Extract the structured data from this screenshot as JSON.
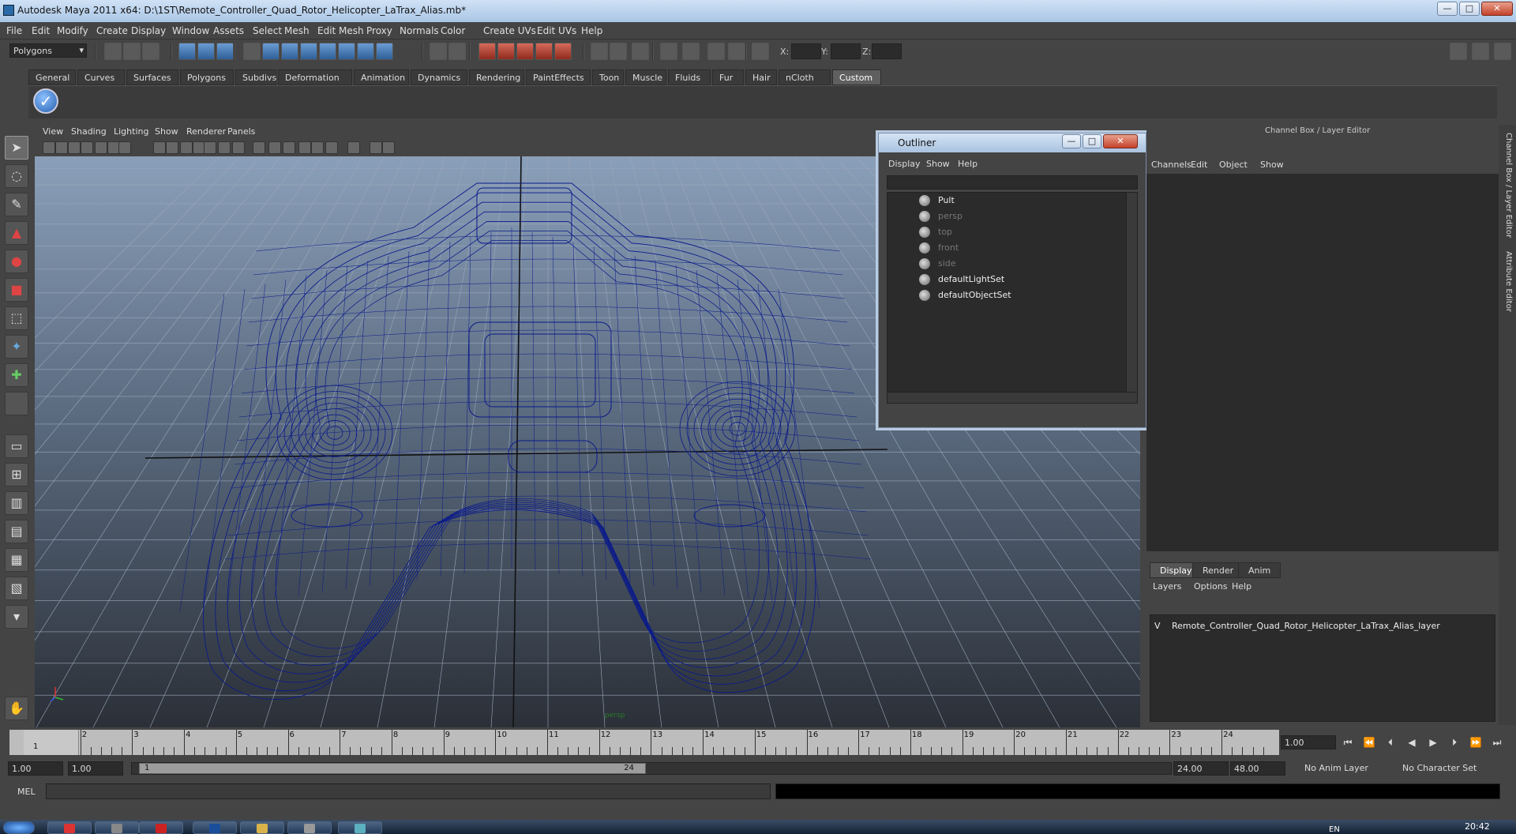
{
  "window": {
    "title": "Autodesk Maya 2011 x64: D:\\1ST\\Remote_Controller_Quad_Rotor_Helicopter_LaTrax_Alias.mb*",
    "min": "—",
    "max": "□",
    "close": "✕"
  },
  "menubar": [
    "File",
    "Edit",
    "Modify",
    "Create",
    "Display",
    "Window",
    "Assets",
    "Select",
    "Mesh",
    "Edit Mesh",
    "Proxy",
    "Normals",
    "Color",
    "Create UVs",
    "Edit UVs",
    "Help"
  ],
  "status": {
    "menuset": "Polygons",
    "x_label": "X:",
    "y_label": "Y:",
    "z_label": "Z:"
  },
  "shelf": {
    "tabs": [
      "General",
      "Curves",
      "Surfaces",
      "Polygons",
      "Subdivs",
      "Deformation",
      "Animation",
      "Dynamics",
      "Rendering",
      "PaintEffects",
      "Toon",
      "Muscle",
      "Fluids",
      "Fur",
      "Hair",
      "nCloth",
      "Custom"
    ],
    "active": "Custom"
  },
  "viewport": {
    "menu": [
      "View",
      "Shading",
      "Lighting",
      "Show",
      "Renderer",
      "Panels"
    ],
    "camera_label": "persp",
    "wire_color": "#0a1a8a"
  },
  "outliner": {
    "title": "Outliner",
    "menu": [
      "Display",
      "Show",
      "Help"
    ],
    "items": [
      {
        "label": "Pult",
        "dim": false
      },
      {
        "label": "persp",
        "dim": true
      },
      {
        "label": "top",
        "dim": true
      },
      {
        "label": "front",
        "dim": true
      },
      {
        "label": "side",
        "dim": true
      },
      {
        "label": "defaultLightSet",
        "dim": false
      },
      {
        "label": "defaultObjectSet",
        "dim": false
      }
    ]
  },
  "channelbox": {
    "header": "Channel Box / Layer Editor",
    "menu": [
      "Channels",
      "Edit",
      "Object",
      "Show"
    ],
    "side_tabs": [
      "Channel Box / Layer Editor",
      "Attribute Editor"
    ]
  },
  "layers": {
    "tabs": [
      "Display",
      "Render",
      "Anim"
    ],
    "active": "Display",
    "menu": [
      "Layers",
      "Options",
      "Help"
    ],
    "rows": [
      {
        "visible": "V",
        "name": "Remote_Controller_Quad_Rotor_Helicopter_LaTrax_Alias_layer"
      }
    ]
  },
  "timeline": {
    "ticks": [
      "1",
      "2",
      "3",
      "4",
      "5",
      "6",
      "7",
      "8",
      "9",
      "10",
      "11",
      "12",
      "13",
      "14",
      "15",
      "16",
      "17",
      "18",
      "19",
      "20",
      "21",
      "22",
      "23",
      "24"
    ],
    "current_frame_marker": "1",
    "current_frame": "1.00"
  },
  "range": {
    "start_time": "1.00",
    "start_range": "1.00",
    "slider_start": "1",
    "slider_end": "24",
    "end_range": "24.00",
    "end_time": "48.00",
    "anim_layer": "No Anim Layer",
    "char_set": "No Character Set"
  },
  "command": {
    "label": "MEL"
  },
  "taskbar": {
    "lang": "EN",
    "clock": "20:42"
  }
}
